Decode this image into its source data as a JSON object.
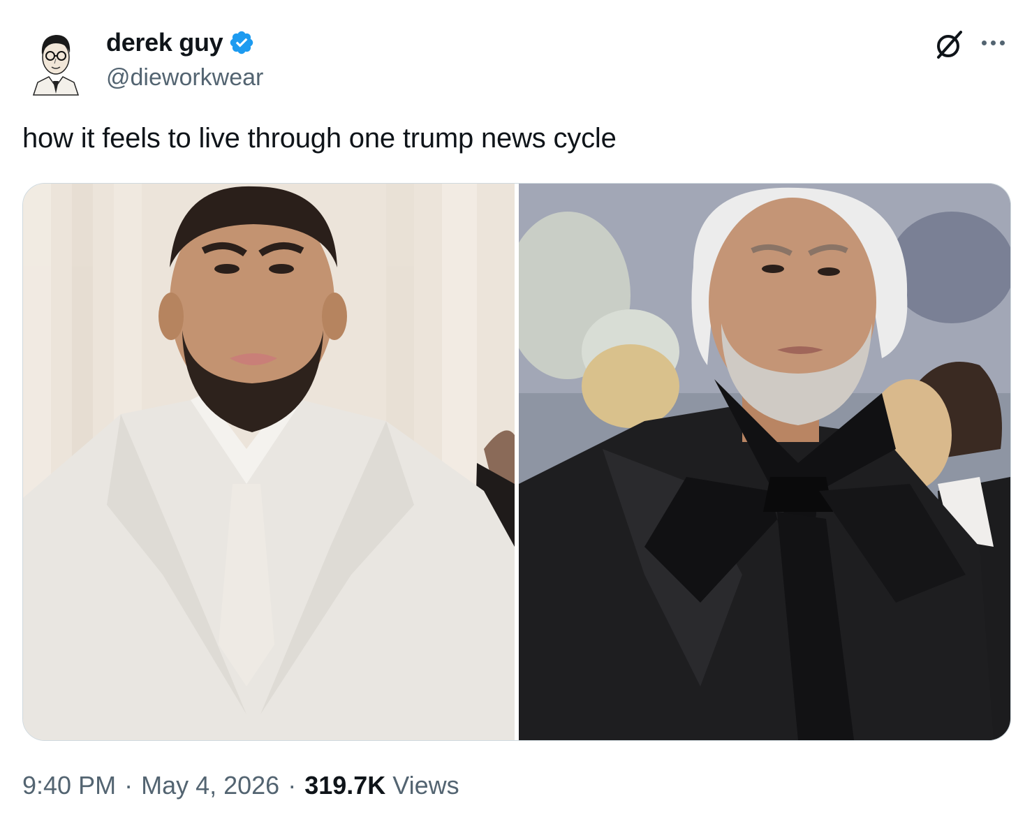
{
  "tweet": {
    "author": {
      "name": "derek guy",
      "handle": "@dieworkwear",
      "verified": true,
      "avatar_icon": "sketch-portrait-avatar"
    },
    "text": "how it feels to live through one trump news cycle",
    "media": [
      {
        "icon": "photo-young-man-white-suit"
      },
      {
        "icon": "photo-aged-man-black-bow"
      }
    ],
    "time": "9:40 PM",
    "date": "May 4, 2026",
    "views_count": "319.7K",
    "views_label": "Views",
    "separator": "·"
  },
  "colors": {
    "text": "#0f1419",
    "secondary": "#536471",
    "verified_blue": "#1d9bf0",
    "border": "#cfd9de"
  }
}
